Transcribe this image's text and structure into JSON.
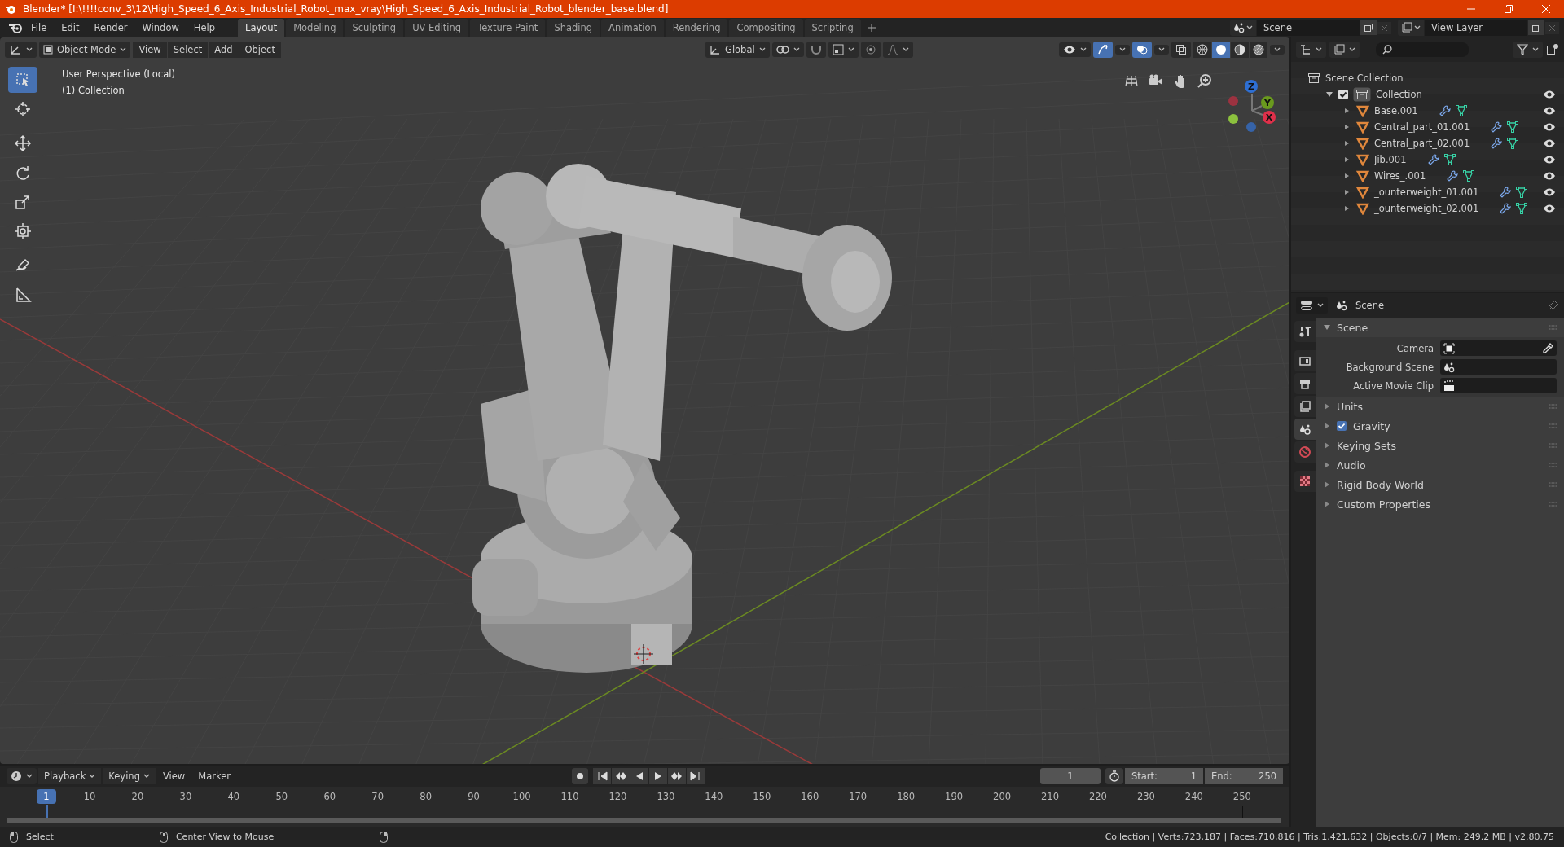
{
  "window": {
    "title": "Blender* [I:\\!!!!conv_3\\12\\High_Speed_6_Axis_Industrial_Robot_max_vray\\High_Speed_6_Axis_Industrial_Robot_blender_base.blend]"
  },
  "menu": [
    "File",
    "Edit",
    "Render",
    "Window",
    "Help"
  ],
  "workspaces": [
    {
      "label": "Layout",
      "selected": true
    },
    {
      "label": "Modeling",
      "selected": false
    },
    {
      "label": "Sculpting",
      "selected": false
    },
    {
      "label": "UV Editing",
      "selected": false
    },
    {
      "label": "Texture Paint",
      "selected": false
    },
    {
      "label": "Shading",
      "selected": false
    },
    {
      "label": "Animation",
      "selected": false
    },
    {
      "label": "Rendering",
      "selected": false
    },
    {
      "label": "Compositing",
      "selected": false
    },
    {
      "label": "Scripting",
      "selected": false
    }
  ],
  "scene_selector": {
    "value": "Scene"
  },
  "view_layer_selector": {
    "value": "View Layer"
  },
  "viewport_header": {
    "mode": "Object Mode",
    "menus": [
      "View",
      "Select",
      "Add",
      "Object"
    ],
    "orientation": "Global",
    "shading_modes": [
      {
        "kind": "wireframe",
        "selected": false
      },
      {
        "kind": "solid",
        "selected": true
      },
      {
        "kind": "material",
        "selected": false
      },
      {
        "kind": "rendered",
        "selected": false
      }
    ]
  },
  "tools": [
    {
      "kind": "select",
      "selected": true
    },
    {
      "kind": "cursor",
      "selected": false
    },
    {
      "kind": "move",
      "selected": false
    },
    {
      "kind": "rotate",
      "selected": false
    },
    {
      "kind": "scale",
      "selected": false
    },
    {
      "kind": "transform",
      "selected": false
    },
    {
      "kind": "annotate",
      "selected": false
    },
    {
      "kind": "measure",
      "selected": false
    }
  ],
  "viewport": {
    "view_name": "User Perspective (Local)",
    "collection": "(1) Collection",
    "gizmo_axes": [
      {
        "label": "Z",
        "color": "#2e6fd3"
      },
      {
        "label": "Y",
        "color": "#6a9a1e"
      },
      {
        "label": "X",
        "color": "#e0304a"
      }
    ]
  },
  "outliner": {
    "label": "Scene Collection",
    "children": [
      {
        "label": "Collection",
        "expanded": true,
        "checked": true,
        "children": [
          {
            "label": "Base.001",
            "expanded": false
          },
          {
            "label": "Central_part_01.001",
            "expanded": false
          },
          {
            "label": "Central_part_02.001",
            "expanded": false
          },
          {
            "label": "Jib.001",
            "expanded": false
          },
          {
            "label": "Wires_.001",
            "expanded": false
          },
          {
            "label": "_ounterweight_01.001",
            "expanded": false
          },
          {
            "label": "_ounterweight_02.001",
            "expanded": false
          }
        ]
      }
    ]
  },
  "properties": {
    "context": "Scene",
    "tabs": [
      {
        "kind": "tool",
        "selected": false
      },
      {
        "kind": "render",
        "selected": false
      },
      {
        "kind": "output",
        "selected": false
      },
      {
        "kind": "view_layer",
        "selected": false
      },
      {
        "kind": "scene",
        "selected": true
      },
      {
        "kind": "world",
        "selected": false
      },
      {
        "kind": "texture",
        "selected": false
      }
    ],
    "panel": {
      "title": "Scene",
      "expanded": true,
      "fields": [
        {
          "label": "Camera",
          "kind": "camera"
        },
        {
          "label": "Background Scene",
          "kind": "scene"
        },
        {
          "label": "Active Movie Clip",
          "kind": "clip"
        }
      ]
    },
    "subpanels": [
      {
        "label": "Units",
        "expanded": false,
        "kind": "plain"
      },
      {
        "label": "Gravity",
        "expanded": false,
        "kind": "checkbox",
        "checked": true
      },
      {
        "label": "Keying Sets",
        "expanded": false,
        "kind": "plain"
      },
      {
        "label": "Audio",
        "expanded": false,
        "kind": "plain"
      },
      {
        "label": "Rigid Body World",
        "expanded": false,
        "kind": "plain"
      },
      {
        "label": "Custom Properties",
        "expanded": false,
        "kind": "plain"
      }
    ]
  },
  "timeline": {
    "menus": [
      "Playback",
      "Keying",
      "View",
      "Marker"
    ],
    "current_frame": "1",
    "start_label": "Start:",
    "start": "1",
    "end_label": "End:",
    "end": "250",
    "playhead": "1",
    "ruler": [
      "10",
      "20",
      "30",
      "40",
      "50",
      "60",
      "70",
      "80",
      "90",
      "100",
      "110",
      "120",
      "130",
      "140",
      "150",
      "160",
      "170",
      "180",
      "190",
      "200",
      "210",
      "220",
      "230",
      "240",
      "250"
    ]
  },
  "status_bar": {
    "hints": [
      "Select",
      "Center View to Mouse"
    ],
    "stats": "Collection | Verts:723,187 | Faces:710,816 | Tris:1,421,632 | Objects:0/7 | Mem: 249.2 MB | v2.80.75"
  }
}
